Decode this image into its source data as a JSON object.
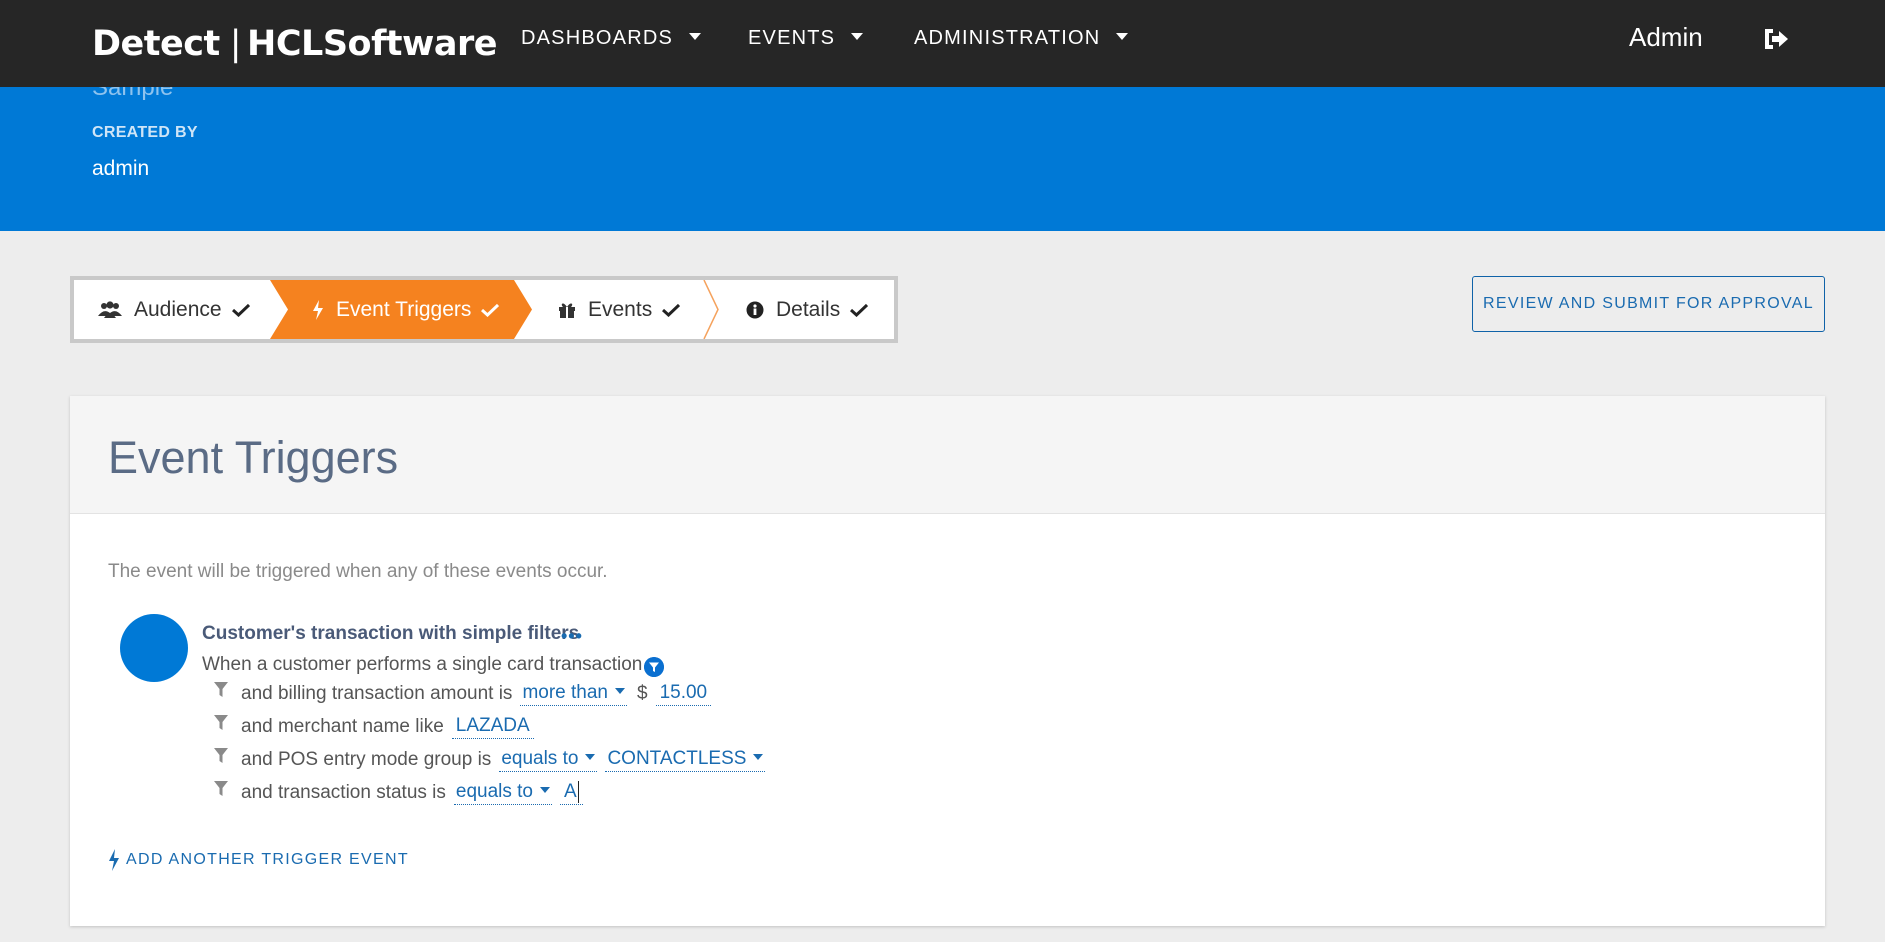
{
  "brand": {
    "product": "Detect",
    "separator": "|",
    "company": "HCLSoftware"
  },
  "nav": {
    "items": [
      {
        "label": "DASHBOARDS"
      },
      {
        "label": "EVENTS"
      },
      {
        "label": "ADMINISTRATION"
      }
    ]
  },
  "user": {
    "name": "Admin"
  },
  "hero": {
    "partial_text": "Sample",
    "created_by_label": "CREATED BY",
    "created_by_value": "admin"
  },
  "stepper": {
    "steps": [
      {
        "label": "Audience",
        "icon": "users-icon",
        "done": true,
        "active": false
      },
      {
        "label": "Event Triggers",
        "icon": "bolt-icon",
        "done": true,
        "active": true
      },
      {
        "label": "Events",
        "icon": "gift-icon",
        "done": true,
        "active": false
      },
      {
        "label": "Details",
        "icon": "info-icon",
        "done": true,
        "active": false
      }
    ]
  },
  "actions": {
    "review_label": "REVIEW AND SUBMIT FOR APPROVAL"
  },
  "card": {
    "title": "Event Triggers",
    "intro": "The event will be triggered when any of these events occur.",
    "trigger": {
      "title": "Customer's transaction with simple filters",
      "description": "When a customer performs a single card transaction",
      "conditions": [
        {
          "text": "and billing transaction amount is",
          "operator": "more than",
          "prefix": "$",
          "value": "15.00"
        },
        {
          "text": "and merchant name like",
          "value": "LAZADA"
        },
        {
          "text": "and POS entry mode group is",
          "operator": "equals to",
          "value": "CONTACTLESS"
        },
        {
          "text": "and transaction status is",
          "operator": "equals to",
          "value": "A"
        }
      ]
    },
    "add_trigger_label": "ADD ANOTHER TRIGGER EVENT"
  },
  "colors": {
    "topbar": "#262626",
    "header_blue": "#0079d6",
    "active_step": "#f5821f",
    "link_blue": "#1a6bb0"
  }
}
